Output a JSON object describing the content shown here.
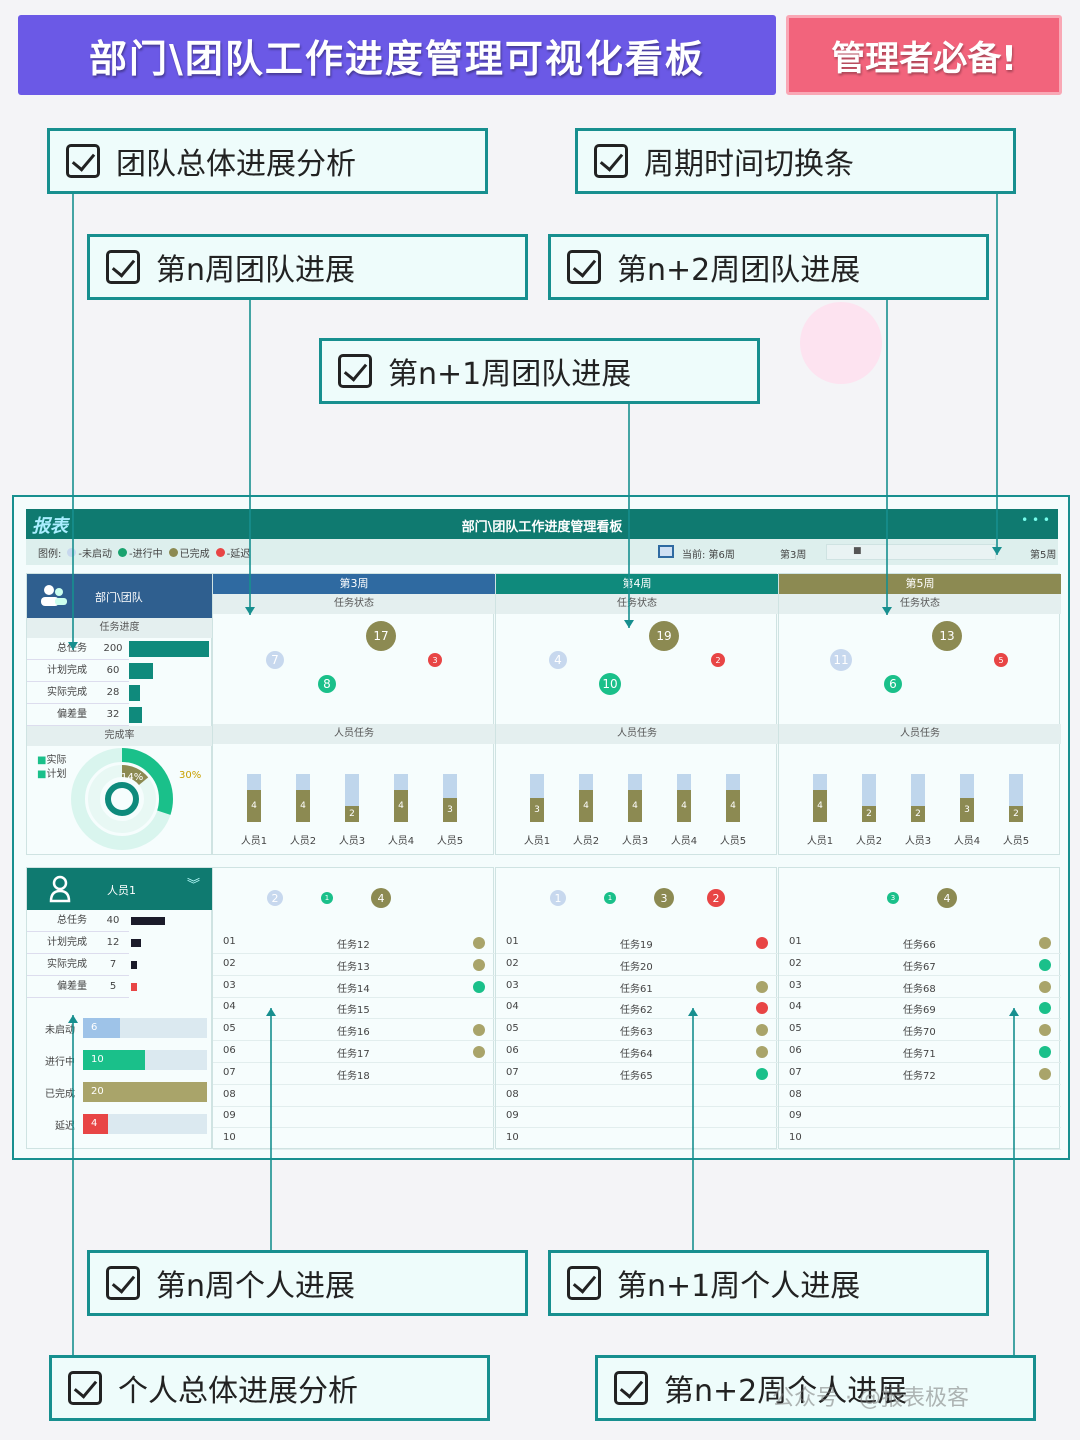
{
  "header": {
    "title": "部门\\团队工作进度管理可视化看板",
    "badge": "管理者必备!"
  },
  "callouts": [
    {
      "label": "团队总体进展分析"
    },
    {
      "label": "周期时间切换条"
    },
    {
      "label": "第n周团队进展"
    },
    {
      "label": "第n+2周团队进展"
    },
    {
      "label": "第n+1周团队进展"
    },
    {
      "label": "第n周个人进展"
    },
    {
      "label": "第n+1周个人进展"
    },
    {
      "label": "个人总体进展分析"
    },
    {
      "label": "第n+2周个人进展"
    }
  ],
  "watermark": "公众号 · @报表极客",
  "dashboard": {
    "logo": "报表",
    "title": "部门\\团队工作进度管理看板",
    "legend": {
      "prefix": "图例:",
      "items": [
        {
          "label": "-未启动",
          "color": "#c7d8ee"
        },
        {
          "label": "-进行中",
          "color": "#1aa36f"
        },
        {
          "label": "已完成",
          "color": "#8c8a52"
        },
        {
          "label": "-延迟",
          "color": "#e84545"
        }
      ]
    },
    "period": {
      "current": "当前: 第6周",
      "start": "第3周",
      "end": "第5周",
      "thumb": "■"
    },
    "team": {
      "name": "部门\\团队",
      "progress_title": "任务进度",
      "rows": [
        {
          "label": "总任务",
          "value": "200",
          "fill": 1.0
        },
        {
          "label": "计划完成",
          "value": "60",
          "fill": 0.3
        },
        {
          "label": "实际完成",
          "value": "28",
          "fill": 0.14
        },
        {
          "label": "偏差量",
          "value": "32",
          "fill": 0.16
        }
      ],
      "rate_title": "完成率",
      "rate_legend": [
        "实际",
        "计划"
      ],
      "actual_pct": "14%",
      "plan_pct": "30%",
      "actual_value": 0.14,
      "plan_value": 0.3
    },
    "weeks": [
      {
        "name": "第3周",
        "color": "#2f6aa1",
        "status_label": "任务状态",
        "people_label": "人员任务",
        "status": {
          "not_started": "7",
          "in_progress": "8",
          "done": "17",
          "delayed": "3"
        },
        "people": [
          {
            "name": "人员1",
            "total": 6,
            "done": 4
          },
          {
            "name": "人员2",
            "total": 6,
            "done": 4
          },
          {
            "name": "人员3",
            "total": 6,
            "done": 2
          },
          {
            "name": "人员4",
            "total": 6,
            "done": 4
          },
          {
            "name": "人员5",
            "total": 6,
            "done": 3
          }
        ],
        "p_status": {
          "not_started": "2",
          "in_progress": "1",
          "done": "4"
        },
        "tasks": [
          {
            "no": "01",
            "name": "任务12",
            "color": "#a9a46a"
          },
          {
            "no": "02",
            "name": "任务13",
            "color": "#a9a46a"
          },
          {
            "no": "03",
            "name": "任务14",
            "color": "#1ac08a"
          },
          {
            "no": "04",
            "name": "任务15",
            "color": ""
          },
          {
            "no": "05",
            "name": "任务16",
            "color": "#a9a46a"
          },
          {
            "no": "06",
            "name": "任务17",
            "color": "#a9a46a"
          },
          {
            "no": "07",
            "name": "任务18",
            "color": ""
          },
          {
            "no": "08",
            "name": "",
            "color": ""
          },
          {
            "no": "09",
            "name": "",
            "color": ""
          },
          {
            "no": "10",
            "name": "",
            "color": ""
          }
        ]
      },
      {
        "name": "第4周",
        "color": "#0f8a7c",
        "status_label": "任务状态",
        "people_label": "人员任务",
        "status": {
          "not_started": "4",
          "in_progress": "10",
          "done": "19",
          "delayed": "2"
        },
        "people": [
          {
            "name": "人员1",
            "total": 6,
            "done": 3
          },
          {
            "name": "人员2",
            "total": 6,
            "done": 4
          },
          {
            "name": "人员3",
            "total": 6,
            "done": 4
          },
          {
            "name": "人员4",
            "total": 6,
            "done": 4
          },
          {
            "name": "人员5",
            "total": 6,
            "done": 4
          }
        ],
        "p_status": {
          "not_started": "1",
          "in_progress": "1",
          "done": "3",
          "delayed": "2"
        },
        "tasks": [
          {
            "no": "01",
            "name": "任务19",
            "color": "#e84545"
          },
          {
            "no": "02",
            "name": "任务20",
            "color": ""
          },
          {
            "no": "03",
            "name": "任务61",
            "color": "#a9a46a"
          },
          {
            "no": "04",
            "name": "任务62",
            "color": "#e84545"
          },
          {
            "no": "05",
            "name": "任务63",
            "color": "#a9a46a"
          },
          {
            "no": "06",
            "name": "任务64",
            "color": "#a9a46a"
          },
          {
            "no": "07",
            "name": "任务65",
            "color": "#1ac08a"
          },
          {
            "no": "08",
            "name": "",
            "color": ""
          },
          {
            "no": "09",
            "name": "",
            "color": ""
          },
          {
            "no": "10",
            "name": "",
            "color": ""
          }
        ]
      },
      {
        "name": "第5周",
        "color": "#8c8a52",
        "status_label": "任务状态",
        "people_label": "人员任务",
        "status": {
          "not_started": "11",
          "in_progress": "6",
          "done": "13",
          "delayed": "5"
        },
        "people": [
          {
            "name": "人员1",
            "total": 6,
            "done": 4
          },
          {
            "name": "人员2",
            "total": 6,
            "done": 2
          },
          {
            "name": "人员3",
            "total": 6,
            "done": 2
          },
          {
            "name": "人员4",
            "total": 6,
            "done": 3
          },
          {
            "name": "人员5",
            "total": 6,
            "done": 2
          }
        ],
        "p_status": {
          "in_progress": "3",
          "done": "4"
        },
        "tasks": [
          {
            "no": "01",
            "name": "任务66",
            "color": "#a9a46a"
          },
          {
            "no": "02",
            "name": "任务67",
            "color": "#1ac08a"
          },
          {
            "no": "03",
            "name": "任务68",
            "color": "#a9a46a"
          },
          {
            "no": "04",
            "name": "任务69",
            "color": "#1ac08a"
          },
          {
            "no": "05",
            "name": "任务70",
            "color": "#a9a46a"
          },
          {
            "no": "06",
            "name": "任务71",
            "color": "#1ac08a"
          },
          {
            "no": "07",
            "name": "任务72",
            "color": "#a9a46a"
          },
          {
            "no": "08",
            "name": "",
            "color": ""
          },
          {
            "no": "09",
            "name": "",
            "color": ""
          },
          {
            "no": "10",
            "name": "",
            "color": ""
          }
        ]
      }
    ],
    "person": {
      "name": "人员1",
      "rows": [
        {
          "label": "总任务",
          "value": "40",
          "fill": 1.0,
          "color": "#1b1b2a"
        },
        {
          "label": "计划完成",
          "value": "12",
          "fill": 0.3,
          "color": "#1b1b2a"
        },
        {
          "label": "实际完成",
          "value": "7",
          "fill": 0.17,
          "color": "#1b1b2a"
        },
        {
          "label": "偏差量",
          "value": "5",
          "fill": 0.13,
          "color": "#e84545"
        }
      ],
      "status_bars": [
        {
          "label": "未启动",
          "value": "6",
          "fill": 0.3,
          "color": "#9ec3e8"
        },
        {
          "label": "进行中",
          "value": "10",
          "fill": 0.5,
          "color": "#1ac08a"
        },
        {
          "label": "已完成",
          "value": "20",
          "fill": 1.0,
          "color": "#a9a46a"
        },
        {
          "label": "延迟",
          "value": "4",
          "fill": 0.2,
          "color": "#e84545"
        }
      ]
    }
  }
}
